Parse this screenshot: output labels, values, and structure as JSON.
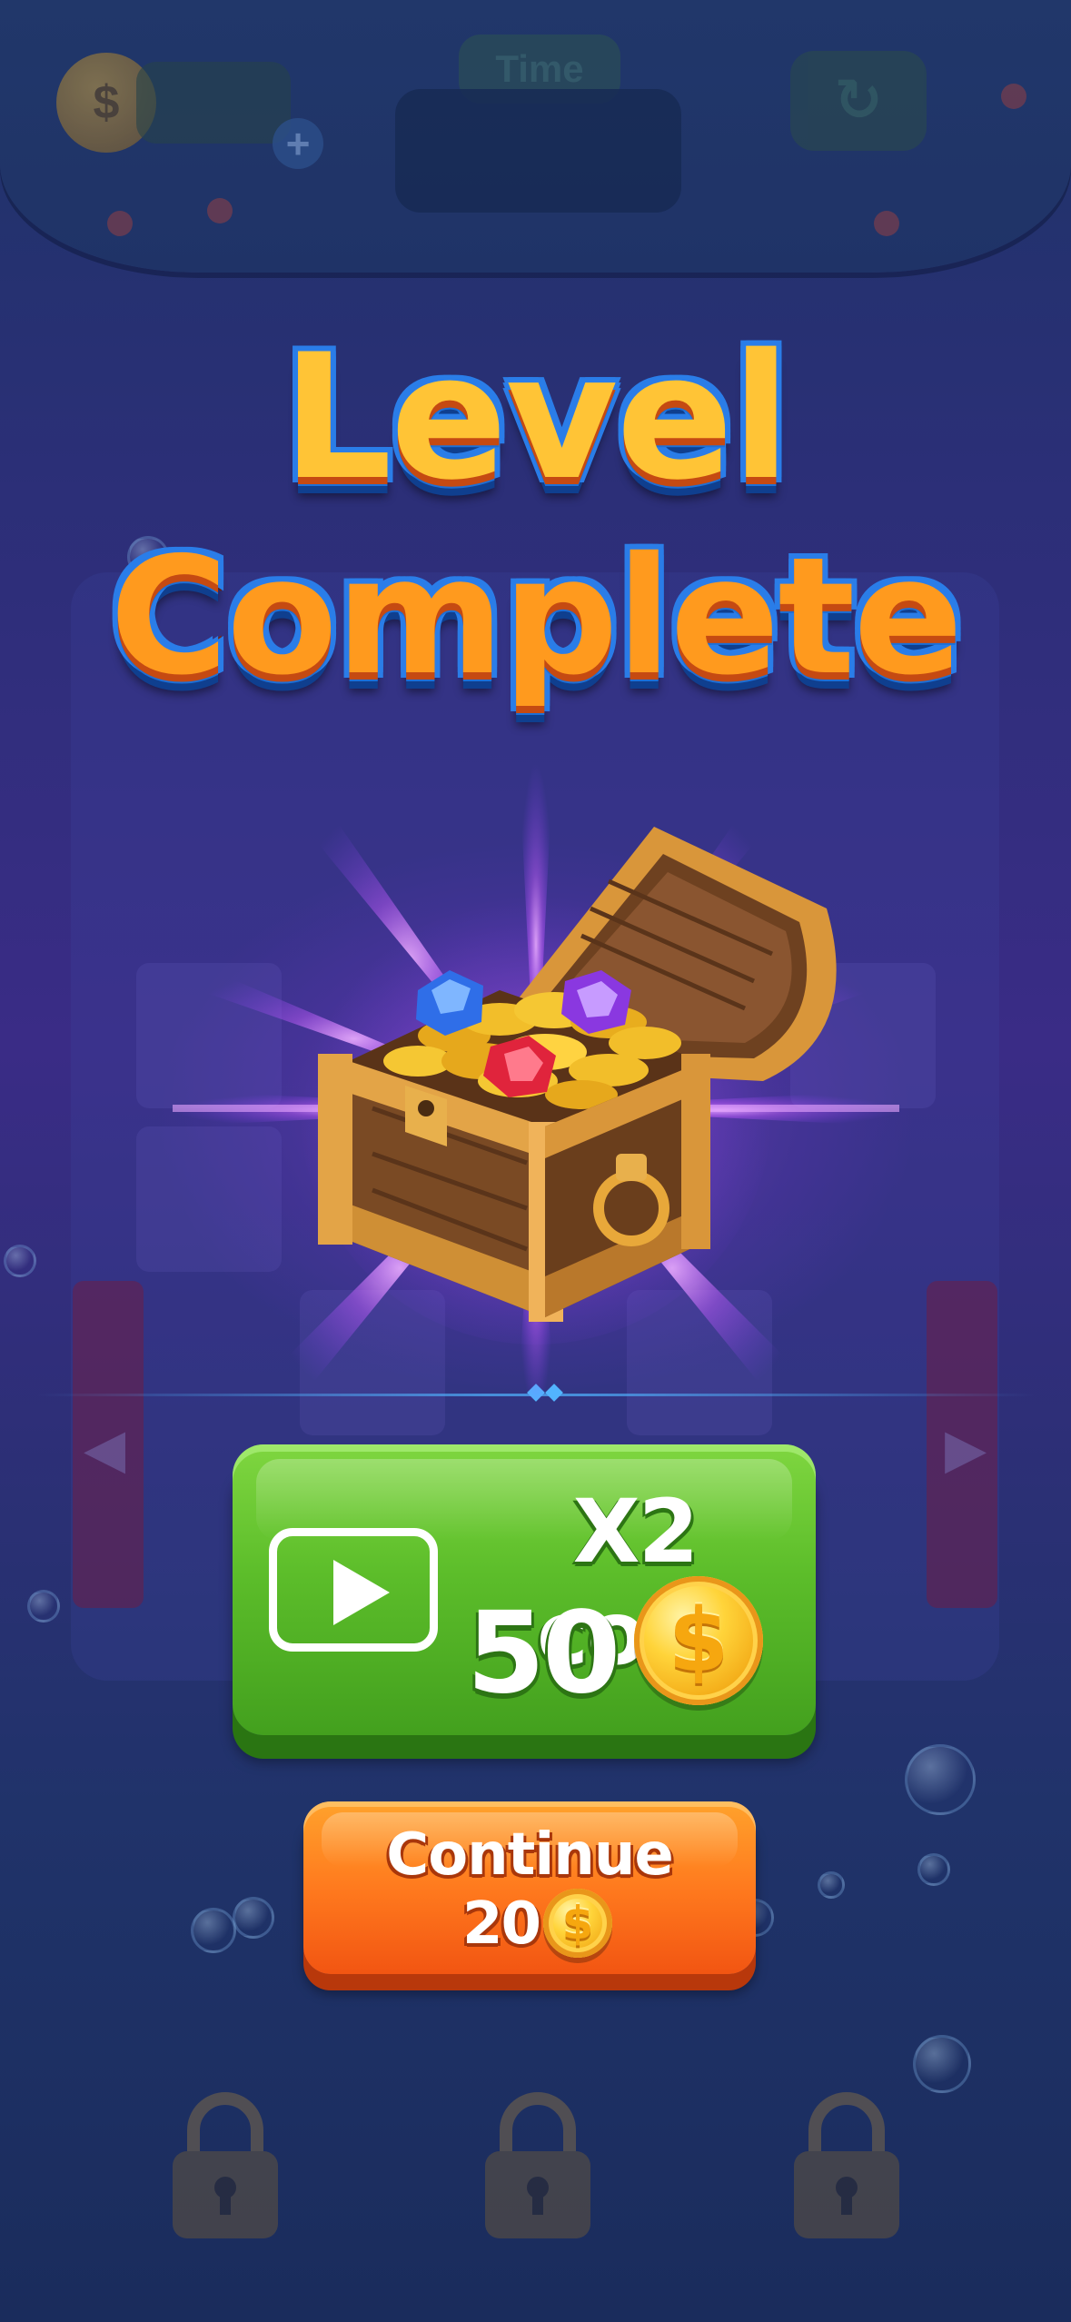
{
  "hud": {
    "coin_icon": "dollar-coin-icon",
    "add_icon": "plus-icon",
    "time_label": "Time",
    "restart_icon": "restart-icon"
  },
  "dialog": {
    "title_line1": "Level",
    "title_line2": "Complete",
    "reward_image": "treasure-chest"
  },
  "double_button": {
    "icon": "play-video-icon",
    "label": "X2 coin",
    "amount": "50",
    "coin_icon": "dollar-coin-icon",
    "coin_symbol": "$"
  },
  "continue_button": {
    "label": "Continue",
    "amount": "20",
    "coin_icon": "dollar-coin-icon",
    "coin_symbol": "$"
  },
  "locked_slots": [
    "lock-icon",
    "lock-icon",
    "lock-icon"
  ],
  "colors": {
    "title_yellow": "#ffc436",
    "title_orange": "#ff9a1e",
    "green_button": "#5cbd2a",
    "orange_button": "#ff7a1e",
    "coin_gold": "#ffd43a"
  }
}
